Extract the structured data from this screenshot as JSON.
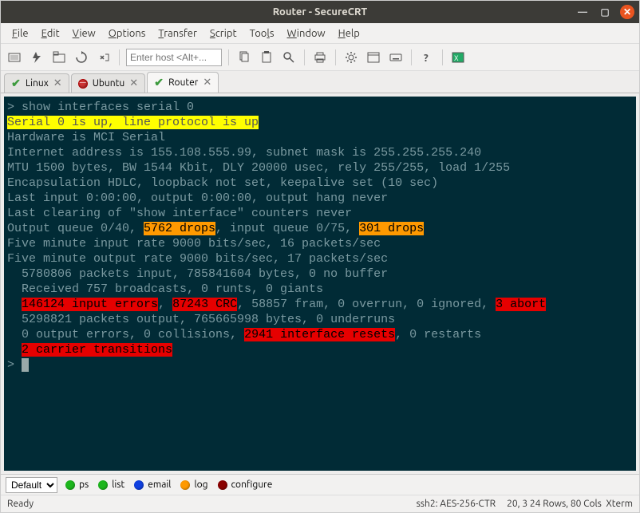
{
  "window": {
    "title": "Router - SecureCRT"
  },
  "menus": [
    "File",
    "Edit",
    "View",
    "Options",
    "Transfer",
    "Script",
    "Tools",
    "Window",
    "Help"
  ],
  "toolbar": {
    "host_placeholder": "Enter host <Alt+..."
  },
  "tabs": [
    {
      "label": "Linux",
      "status": "connected"
    },
    {
      "label": "Ubuntu",
      "status": "disconnected"
    },
    {
      "label": "Router",
      "status": "connected",
      "active": true
    }
  ],
  "terminal": {
    "lines": [
      {
        "segments": [
          {
            "t": "> show interfaces serial 0"
          }
        ]
      },
      {
        "segments": [
          {
            "t": "Serial 0 is up, line protocol is up",
            "c": "hl-y"
          }
        ]
      },
      {
        "segments": [
          {
            "t": "Hardware is MCI Serial"
          }
        ]
      },
      {
        "segments": [
          {
            "t": "Internet address is 155.108.555.99, subnet mask is 255.255.255.240"
          }
        ]
      },
      {
        "segments": [
          {
            "t": "MTU 1500 bytes, BW 1544 Kbit, DLY 20000 usec, rely 255/255, load 1/255"
          }
        ]
      },
      {
        "segments": [
          {
            "t": "Encapsulation HDLC, loopback not set, keepalive set (10 sec)"
          }
        ]
      },
      {
        "segments": [
          {
            "t": "Last input 0:00:00, output 0:00:00, output hang never"
          }
        ]
      },
      {
        "segments": [
          {
            "t": "Last clearing of \"show interface\" counters never"
          }
        ]
      },
      {
        "segments": [
          {
            "t": "Output queue 0/40, "
          },
          {
            "t": "5762 drops",
            "c": "hl-o"
          },
          {
            "t": ", input queue 0/75, "
          },
          {
            "t": "301 drops",
            "c": "hl-o"
          }
        ]
      },
      {
        "segments": [
          {
            "t": "Five minute input rate 9000 bits/sec, 16 packets/sec"
          }
        ]
      },
      {
        "segments": [
          {
            "t": "Five minute output rate 9000 bits/sec, 17 packets/sec"
          }
        ]
      },
      {
        "segments": [
          {
            "t": "  5780806 packets input, 785841604 bytes, 0 no buffer"
          }
        ]
      },
      {
        "segments": [
          {
            "t": "  Received 757 broadcasts, 0 runts, 0 giants"
          }
        ]
      },
      {
        "segments": [
          {
            "t": "  "
          },
          {
            "t": "146124 input errors",
            "c": "hl-r"
          },
          {
            "t": ", "
          },
          {
            "t": "87243 CRC",
            "c": "hl-r"
          },
          {
            "t": ", 58857 fram, 0 overrun, 0 ignored, "
          },
          {
            "t": "3 abort",
            "c": "hl-r"
          }
        ]
      },
      {
        "segments": [
          {
            "t": "  5298821 packets output, 765665998 bytes, 0 underruns"
          }
        ]
      },
      {
        "segments": [
          {
            "t": "  0 output errors, 0 collisions, "
          },
          {
            "t": "2941 interface resets",
            "c": "hl-r"
          },
          {
            "t": ", 0 restarts"
          }
        ]
      },
      {
        "segments": [
          {
            "t": "  "
          },
          {
            "t": "2 carrier transitions",
            "c": "hl-r"
          }
        ]
      },
      {
        "segments": [
          {
            "t": ""
          }
        ]
      },
      {
        "prompt": "> ",
        "cursor": true
      }
    ]
  },
  "buttonbar": {
    "scheme": "Default",
    "buttons": [
      {
        "color": "green",
        "label": "ps"
      },
      {
        "color": "green",
        "label": "list"
      },
      {
        "color": "blue",
        "label": "email"
      },
      {
        "color": "orange",
        "label": "log"
      },
      {
        "color": "darkred",
        "label": "configure"
      }
    ]
  },
  "status": {
    "left": "Ready",
    "protocol": "ssh2: AES-256-CTR",
    "pos": "20,  3",
    "dims": "24 Rows, 80 Cols",
    "emu": "Xterm"
  }
}
